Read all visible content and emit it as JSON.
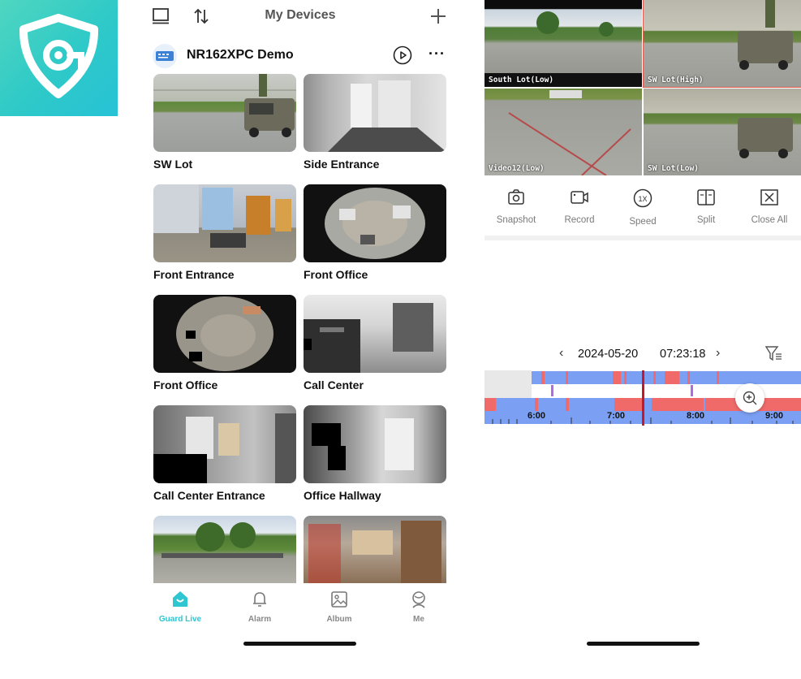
{
  "left_screen": {
    "title": "My Devices",
    "device": {
      "name": "NR162XPC Demo"
    },
    "cameras": [
      {
        "label": "SW Lot"
      },
      {
        "label": "Side Entrance"
      },
      {
        "label": "Front Entrance"
      },
      {
        "label": "Front Office"
      },
      {
        "label": "Front Office"
      },
      {
        "label": "Call Center"
      },
      {
        "label": "Call Center Entrance"
      },
      {
        "label": "Office Hallway"
      },
      {
        "label": ""
      },
      {
        "label": ""
      }
    ],
    "tabs": [
      {
        "label": "Guard Live",
        "icon": "home-icon",
        "active": true
      },
      {
        "label": "Alarm",
        "icon": "bell-icon",
        "active": false
      },
      {
        "label": "Album",
        "icon": "image-icon",
        "active": false
      },
      {
        "label": "Me",
        "icon": "person-icon",
        "active": false
      }
    ],
    "accent": "#2fc6d2"
  },
  "right_screen": {
    "tiles": [
      {
        "caption": "South Lot(Low)"
      },
      {
        "caption": "SW Lot(High)"
      },
      {
        "caption": "Video12(Low)"
      },
      {
        "caption": "SW Lot(Low)"
      }
    ],
    "controls": [
      {
        "label": "Snapshot",
        "icon": "camera-icon"
      },
      {
        "label": "Record",
        "icon": "video-icon"
      },
      {
        "label": "Speed",
        "icon": "speed-icon"
      },
      {
        "label": "Split",
        "icon": "split-icon"
      },
      {
        "label": "Close All",
        "icon": "close-all-icon"
      }
    ],
    "playback": {
      "date": "2024-05-20",
      "time": "07:23:18"
    },
    "timeline": {
      "ticks": [
        "6:00",
        "7:00",
        "8:00",
        "9:00"
      ],
      "colors": {
        "normal": "#7b9ff2",
        "event": "#f06a6a",
        "marker": "#c21a2c",
        "motion": "#b06be0"
      }
    }
  }
}
